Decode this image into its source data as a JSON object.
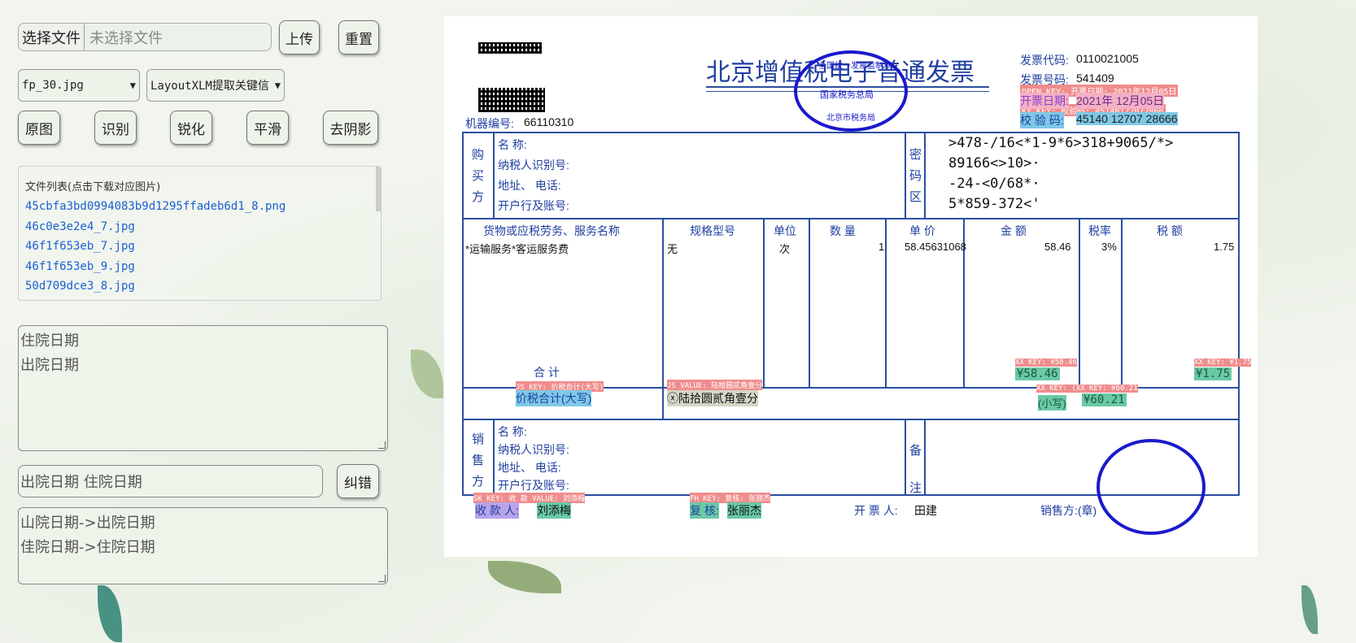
{
  "controls": {
    "choose_file": "选择文件",
    "no_file": "未选择文件",
    "upload": "上传",
    "reset": "重置",
    "file_select": "fp_30.jpg",
    "mode_select": "LayoutXLM提取关键信",
    "original": "原图",
    "recognize": "识别",
    "sharpen": "锐化",
    "smooth": "平滑",
    "deshadow": "去阴影",
    "correct": "纠错"
  },
  "file_list": {
    "header": "文件列表(点击下载对应图片)",
    "files": [
      "45cbfa3bd0994083b9d1295ffadeb6d1_8.png",
      "46c0e3e2e4_7.jpg",
      "46f1f653eb_7.jpg",
      "46f1f653eb_9.jpg",
      "50d709dce3_8.jpg"
    ]
  },
  "keys_textarea": [
    "住院日期",
    "出院日期"
  ],
  "correct_input": "出院日期 住院日期",
  "result_textarea": [
    "山院日期->出院日期",
    "佳院日期->住院日期"
  ],
  "invoice": {
    "title": "北京增值税电子普通发票",
    "code_label": "发票代码:",
    "code_value": "0110021005",
    "number_label": "发票号码:",
    "number_value": "541409",
    "date_label": "开票日期:",
    "date_value": "2021年 12月05日",
    "check_label": "校 验 码:",
    "check_value": "45140 12707 28666",
    "machine_label": "机器编号:",
    "machine_value": "66110310",
    "stamp_top": "全国统一发票监制章",
    "stamp_mid": "国家税务总局",
    "stamp_bot": "北京市税务局",
    "buyer_side": [
      "购",
      "买",
      "方"
    ],
    "party_fields": [
      "名 称:",
      "纳税人识别号:",
      "地址、 电话:",
      "开户行及账号:"
    ],
    "pwd_side": [
      "密",
      "码",
      "区"
    ],
    "pwd_lines": [
      ">478-/16<*1-9*6>318+9065/*>",
      "89166<>10>·",
      "-24-<0/68*·",
      "5*859-372<'"
    ],
    "headers": [
      "货物或应税劳务、服务名称",
      "规格型号",
      "单位",
      "数 量",
      "单 价",
      "金 额",
      "税率",
      "税 额"
    ],
    "row": [
      "*运输服务*客运服务费",
      "无",
      "次",
      "1",
      "58.45631068",
      "58.46",
      "3%",
      "1.75"
    ],
    "total_label": "合 计",
    "total_amount": "¥58.46",
    "total_tax": "¥1.75",
    "tax_total_label": "价税合计(大写)",
    "tax_total_upper": "ⓧ陆拾圆贰角壹分",
    "small_label": "(小写)",
    "small_value": "¥60.21",
    "seller_side": [
      "销",
      "售",
      "方"
    ],
    "remark_side": [
      "备",
      "注"
    ],
    "payee_label": "收 款 人:",
    "payee_value": "刘添梅",
    "reviewer_label": "复 核:",
    "reviewer_value": "张丽杰",
    "drawer_label": "开 票 人:",
    "drawer_value": "田建",
    "seller_sign": "销售方:(章)",
    "overlay_date": "OPEN KEY: 开票日期: 2021年12月05日",
    "overlay_check": "KY KEY: 校验码: 45140127072866",
    "overlay_total_key": "XX KEY: ¥58.46",
    "overlay_tax_key": "XX KEY: ¥1.75",
    "overlay_upper_key": "JS KEY: 价税合计(大写)",
    "overlay_upper_val": "JS VALUE: 陆拾圆贰角壹分",
    "overlay_small_key": "XX KEY: (XX KEY: ¥60.21",
    "overlay_payee": "SK KEY: 收 款 VALUE: 刘添梅",
    "overlay_reviewer": "FH KEY: 复核: 张丽杰"
  }
}
